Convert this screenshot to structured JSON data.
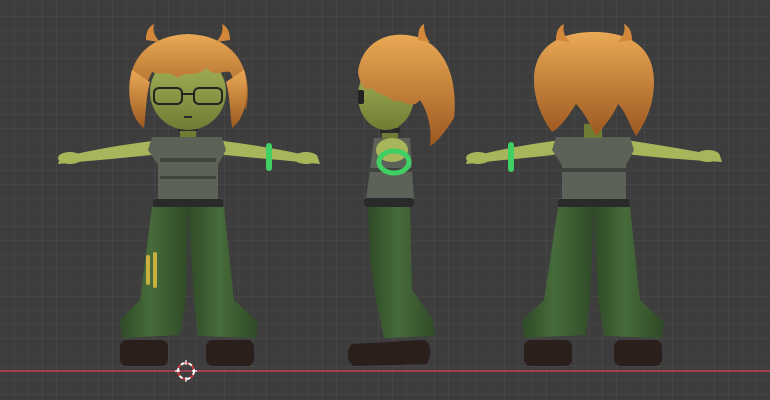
{
  "viewport": {
    "view": "orthographic-multiview",
    "views": [
      "front",
      "side",
      "back"
    ],
    "grid": true,
    "axis_color": "#a0404f",
    "background_color": "#3d3d3d"
  },
  "colors": {
    "skin": "#a8b55a",
    "skin_dark": "#6f7d34",
    "hair": "#d2873a",
    "hair_light": "#eaa955",
    "hair_dark": "#9d5820",
    "top": "#5c6258",
    "top_stripe": "#3e433d",
    "pants": "#476b3a",
    "pants_dark": "#2f4a27",
    "belt": "#2a2a2a",
    "shoes": "#2b1f1c",
    "bracelet": "#3fcf63",
    "glasses": "#222222",
    "patch": "#c8b040"
  },
  "cursor": {
    "icon": "3d-cursor-icon",
    "color_a": "#ffffff",
    "color_b": "#d13838"
  }
}
